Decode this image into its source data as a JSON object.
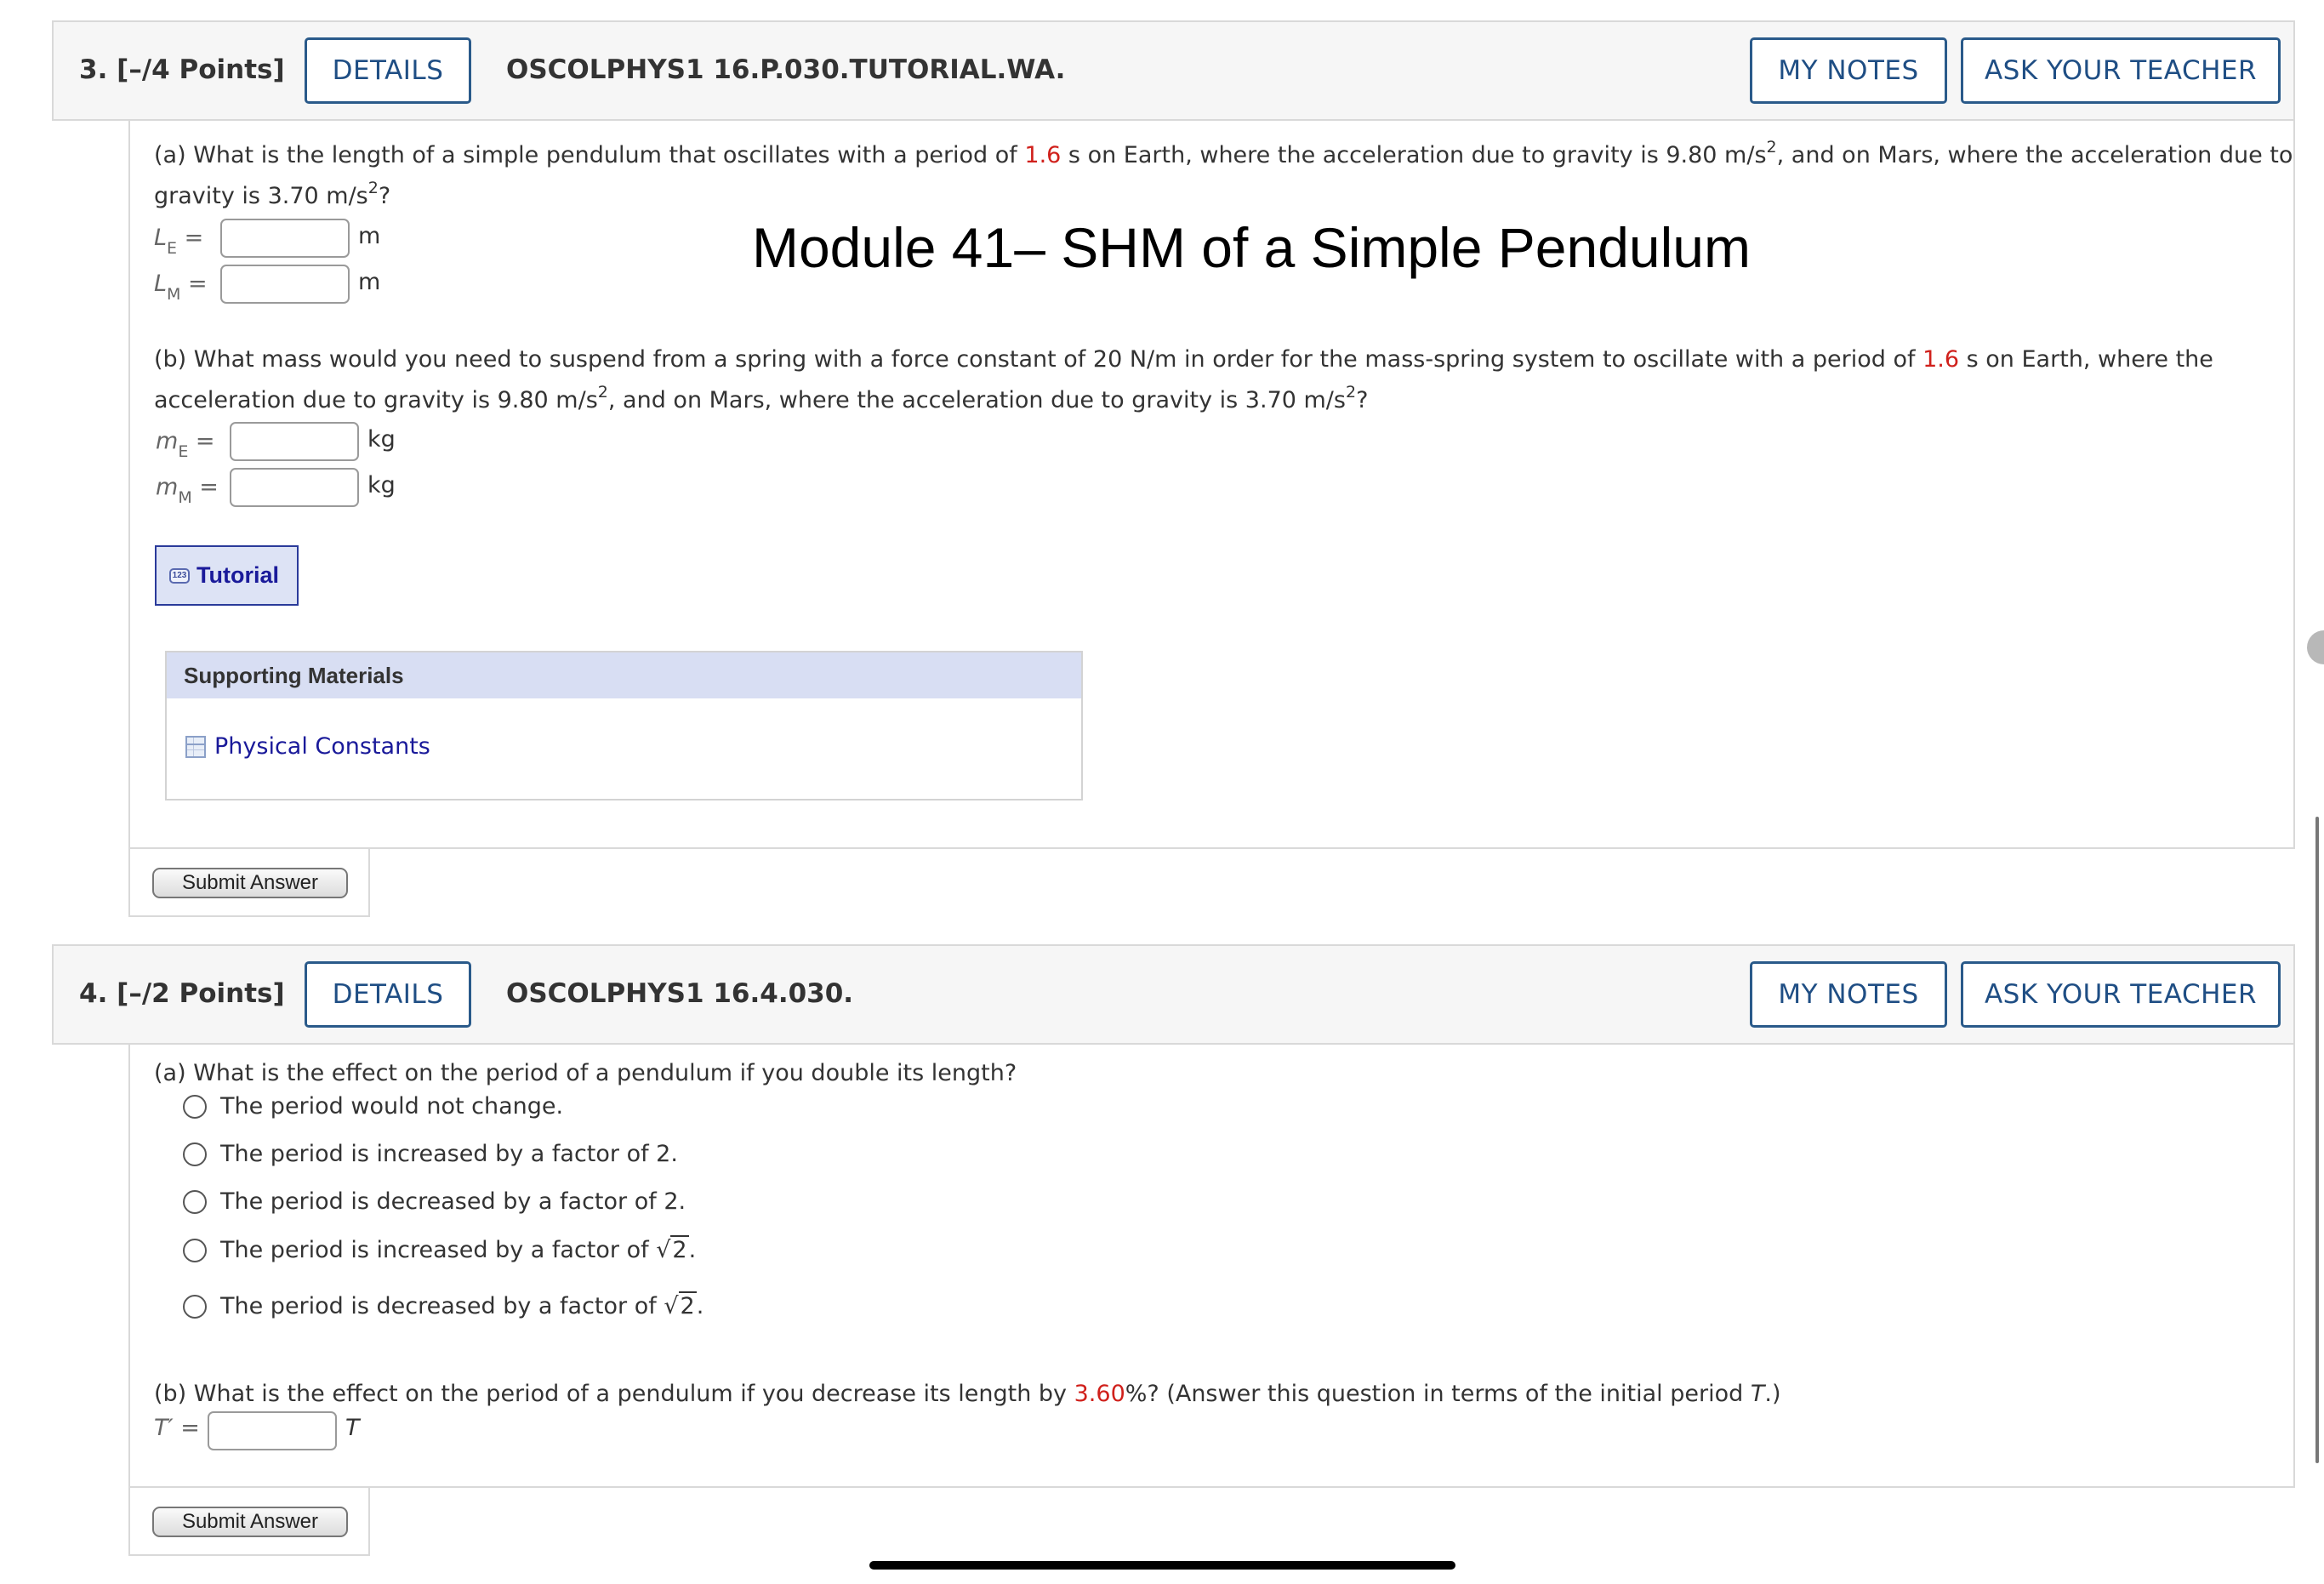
{
  "overlay_title": "Module 41– SHM of a Simple Pendulum",
  "q3": {
    "number": "3.",
    "points": "[–/4 Points]",
    "details": "DETAILS",
    "code": "OSCOLPHYS1 16.P.030.TUTORIAL.WA.",
    "my_notes": "MY NOTES",
    "ask_teacher": "ASK YOUR TEACHER",
    "part_a": {
      "line1_pre": "(a) What is the length of a simple pendulum that oscillates with a period of ",
      "period": "1.6",
      "line1_mid": " s on Earth, where the acceleration due to gravity is 9.80 m/s",
      "sq": "2",
      "line1_post": ", and on Mars, where the acceleration due to",
      "line2_pre": "gravity is 3.70 m/s",
      "line2_post": "?",
      "var1": "L",
      "sub1": "E",
      "var2": "L",
      "sub2": "M",
      "eq": " =",
      "unit": "m"
    },
    "part_b": {
      "line1_pre": "(b) What mass would you need to suspend from a spring with a force constant of 20 N/m in order for the mass-spring system to oscillate with a period of ",
      "period": "1.6",
      "line1_post": " s on Earth, where the",
      "line2_pre": "acceleration due to gravity is 9.80 m/s",
      "sq": "2",
      "line2_mid": ", and on Mars, where the acceleration due to gravity is 3.70 m/s",
      "line2_post": "?",
      "var1": "m",
      "sub1": "E",
      "var2": "m",
      "sub2": "M",
      "eq": " =",
      "unit": "kg"
    },
    "tutorial": "Tutorial",
    "tutorial_icon_text": "123",
    "supporting": {
      "heading": "Supporting Materials",
      "link": "Physical Constants"
    },
    "submit": "Submit Answer"
  },
  "q4": {
    "number": "4.",
    "points": "[–/2 Points]",
    "details": "DETAILS",
    "code": "OSCOLPHYS1 16.4.030.",
    "my_notes": "MY NOTES",
    "ask_teacher": "ASK YOUR TEACHER",
    "part_a": {
      "question": "(a) What is the effect on the period of a pendulum if you double its length?",
      "options": [
        "The period would not change.",
        "The period is increased by a factor of 2.",
        "The period is decreased by a factor of 2.",
        "The period is increased by a factor of ",
        "The period is decreased by a factor of "
      ],
      "sqrt_arg": "2",
      "period_end": "."
    },
    "part_b": {
      "pre": "(b) What is the effect on the period of a pendulum if you decrease its length by ",
      "value": "3.60",
      "post": "%? (Answer this question in terms of the initial period ",
      "T": "T",
      "end": ".)",
      "var": "T′",
      "eq": " =",
      "unit": "T"
    },
    "submit": "Submit Answer"
  },
  "icons": [
    "tutorial-icon",
    "table-icon",
    "scroll-handle"
  ]
}
